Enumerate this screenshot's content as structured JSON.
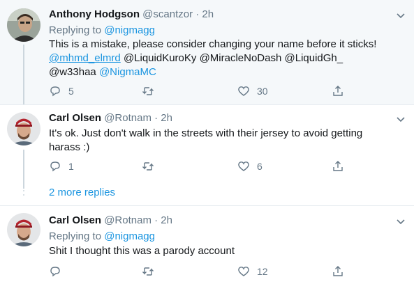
{
  "tweets": [
    {
      "author": "Anthony Hodgson",
      "handle": "@scantzor",
      "time": "2h",
      "replying_label": "Replying to",
      "replying_to": "@nigmagg",
      "text_lines": [
        "This is a mistake, please consider changing your name before it sticks!"
      ],
      "mentions_line1": [
        "@mhmd_elmrd",
        "@LiquidKuroKy",
        "@MiracleNoDash",
        "@LiquidGh_"
      ],
      "mentions_line2": [
        "@w33haa",
        "@NigmaMC"
      ],
      "replies": "5",
      "retweets": "",
      "likes": "30"
    },
    {
      "author": "Carl Olsen",
      "handle": "@Rotnam",
      "time": "2h",
      "text_lines": [
        "It's ok. Just don't walk in the streets with their jersey to avoid getting",
        "harass :)"
      ],
      "replies": "1",
      "retweets": "",
      "likes": "6"
    },
    {
      "author": "Carl Olsen",
      "handle": "@Rotnam",
      "time": "2h",
      "replying_label": "Replying to",
      "replying_to": "@nigmagg",
      "text_lines": [
        "Shit I thought this was a parody account"
      ],
      "replies": "",
      "retweets": "",
      "likes": "12"
    }
  ],
  "more_replies": "2 more replies",
  "separator": "·",
  "colors": {
    "link": "#1b95e0",
    "muted": "#657786",
    "thread": "#ccd6dd",
    "highlight_bg": "#f5f8fa"
  },
  "icons": [
    "avatar",
    "chevron-down-icon",
    "reply-icon",
    "retweet-icon",
    "like-icon",
    "share-icon"
  ]
}
